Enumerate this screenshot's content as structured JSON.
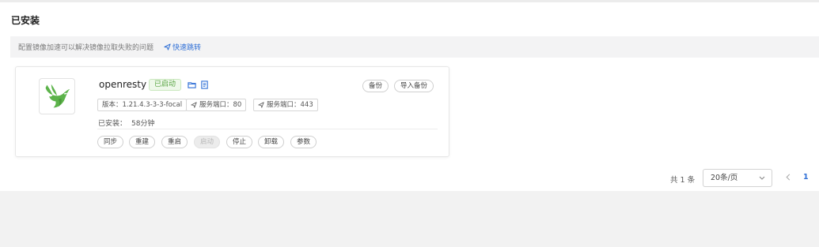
{
  "page": {
    "title": "已安装"
  },
  "notice": {
    "text": "配置镜像加速可以解决镜像拉取失败的问题",
    "link_label": "快速跳转",
    "link_icon": "send-icon"
  },
  "app": {
    "name": "openresty",
    "status": "已启动",
    "logo": "openresty-logo",
    "actions_icons": [
      "folder-icon",
      "document-icon"
    ],
    "version_tag": "版本：1.21.4.3-3-3-focal",
    "port_tags": [
      "服务端口：80",
      "服务端口：443"
    ],
    "installed_label": "已安装：",
    "installed_value": "58分钟",
    "top_buttons": [
      "备份",
      "导入备份"
    ],
    "bottom_buttons": [
      "同步",
      "重建",
      "重启",
      "启动",
      "停止",
      "卸载",
      "参数"
    ],
    "disabled_button": "启动"
  },
  "pagination": {
    "total": "共 1 条",
    "page_size": "20条/页",
    "current_page": "1"
  },
  "colors": {
    "accent": "#2f6fd6",
    "status_green": "#5aa545",
    "logo_green": "#5cb34a"
  }
}
